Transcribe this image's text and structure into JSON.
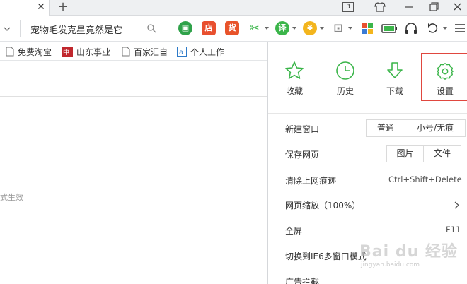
{
  "tabbar": {
    "close_glyph": "✕",
    "new_tab_glyph": "+",
    "tab_count": "3"
  },
  "toolbar": {
    "address_text": "宠物毛发克星竟然是它",
    "extension_icons": [
      {
        "name": "reader-icon",
        "glyph": "▣",
        "color": "#2fa24a"
      },
      {
        "name": "store-icon",
        "glyph": "店",
        "color": "#e8502f"
      },
      {
        "name": "goods-icon",
        "glyph": "货",
        "color": "#e8532a"
      },
      {
        "name": "scissors-icon",
        "glyph": "✂",
        "color": "#3bb54a"
      },
      {
        "name": "translate-icon",
        "glyph": "译",
        "color": "#3bb54a"
      },
      {
        "name": "coupon-icon",
        "glyph": "¥",
        "color": "#f3b51d"
      },
      {
        "name": "game-icon",
        "glyph": "⊡",
        "color": "#888888"
      },
      {
        "name": "apps-icon",
        "glyph": "",
        "color": "#3a7bd5"
      },
      {
        "name": "battery-icon",
        "glyph": "",
        "color": "#3bb54a"
      },
      {
        "name": "headphone-icon",
        "glyph": "",
        "color": "#444444"
      },
      {
        "name": "undo-icon",
        "glyph": "",
        "color": "#444444"
      },
      {
        "name": "menu-icon",
        "glyph": "",
        "color": "#444444"
      }
    ]
  },
  "bookmarks": [
    {
      "label": "免费淘宝",
      "icon": "page-icon"
    },
    {
      "label": "山东事业",
      "icon": "edu-icon"
    },
    {
      "label": "百家汇自",
      "icon": "page-icon"
    },
    {
      "label": "个人工作",
      "icon": "a-icon"
    }
  ],
  "content": {
    "partial_text": "式生效"
  },
  "menu": {
    "quick_actions": [
      {
        "label": "收藏",
        "icon": "star-icon"
      },
      {
        "label": "历史",
        "icon": "clock-icon"
      },
      {
        "label": "下载",
        "icon": "download-icon"
      },
      {
        "label": "设置",
        "icon": "gear-icon"
      }
    ],
    "rows": {
      "new_window": {
        "label": "新建窗口",
        "normal": "普通",
        "private": "小号/无痕"
      },
      "save_page": {
        "label": "保存网页",
        "image": "图片",
        "file": "文件"
      },
      "clear_history": {
        "label": "清除上网痕迹",
        "shortcut": "Ctrl+Shift+Delete"
      },
      "zoom": {
        "label": "网页缩放（100%）"
      },
      "fullscreen": {
        "label": "全屏",
        "shortcut": "F11"
      },
      "ie6_mode": {
        "label": "切换到IE6多窗口模式"
      },
      "ad_block": {
        "label": "广告拦截"
      }
    }
  },
  "watermark": {
    "text": "Bai du 经验",
    "sub": "jingyan.baidu.com"
  },
  "colors": {
    "accent_green": "#3bb54a",
    "highlight_red": "#e0473f"
  }
}
